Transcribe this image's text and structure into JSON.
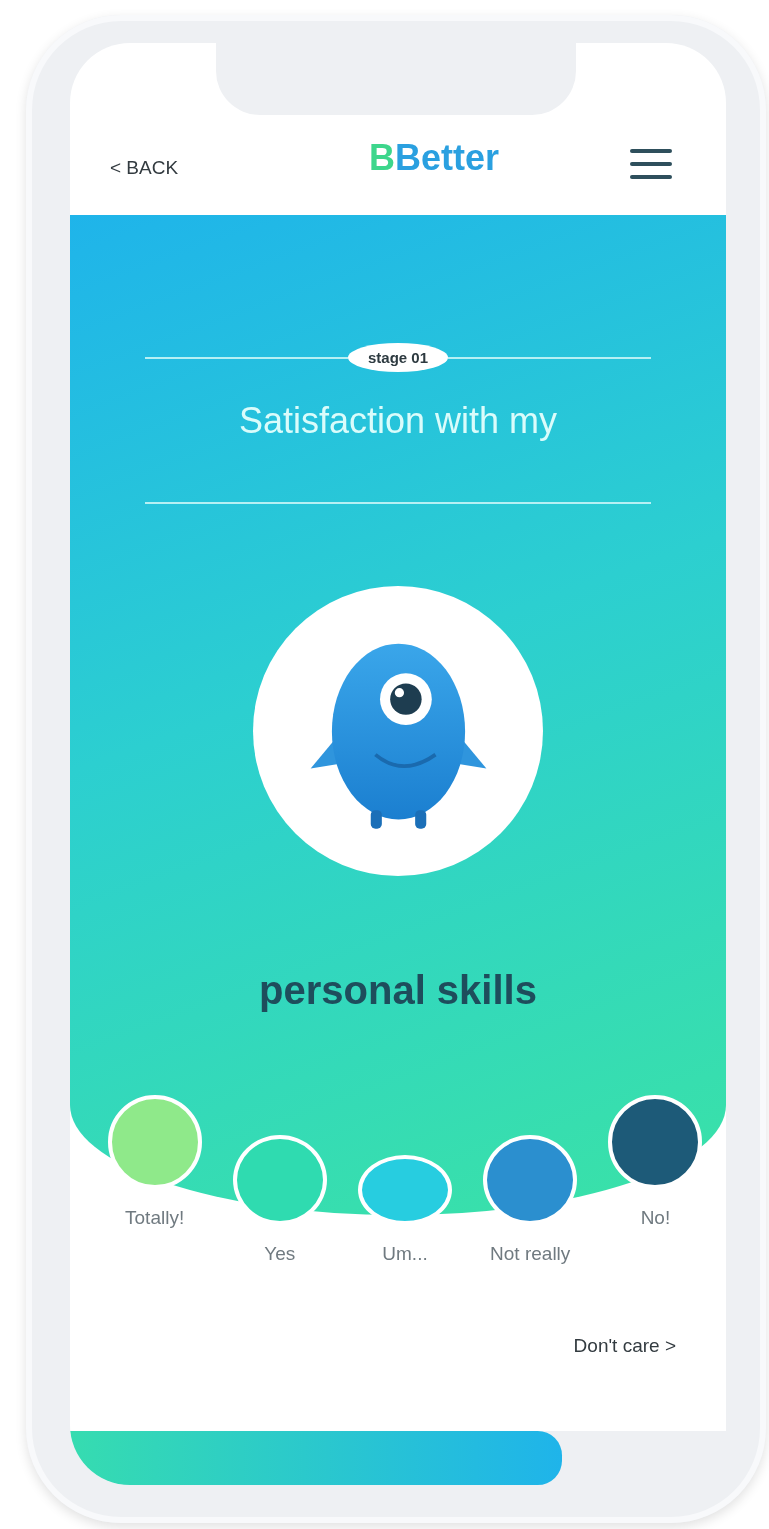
{
  "header": {
    "back": "< BACK",
    "logo": {
      "accent": "B",
      "rest": "Better"
    }
  },
  "stage": {
    "badge": "stage 01",
    "title": "Satisfaction with my",
    "topic": "personal skills"
  },
  "answers": [
    {
      "label": "Totally!",
      "color": "#8fe98a",
      "selected": false
    },
    {
      "label": "Yes",
      "color": "#2fdbb0",
      "selected": false
    },
    {
      "label": "Um...",
      "color": "#27cde0",
      "selected": false
    },
    {
      "label": "Not really",
      "color": "#2b8fcf",
      "selected": false
    },
    {
      "label": "No!",
      "color": "#1d5a78",
      "selected": false
    }
  ],
  "skip": "Don't care >",
  "progress": {
    "level": 0.75
  }
}
